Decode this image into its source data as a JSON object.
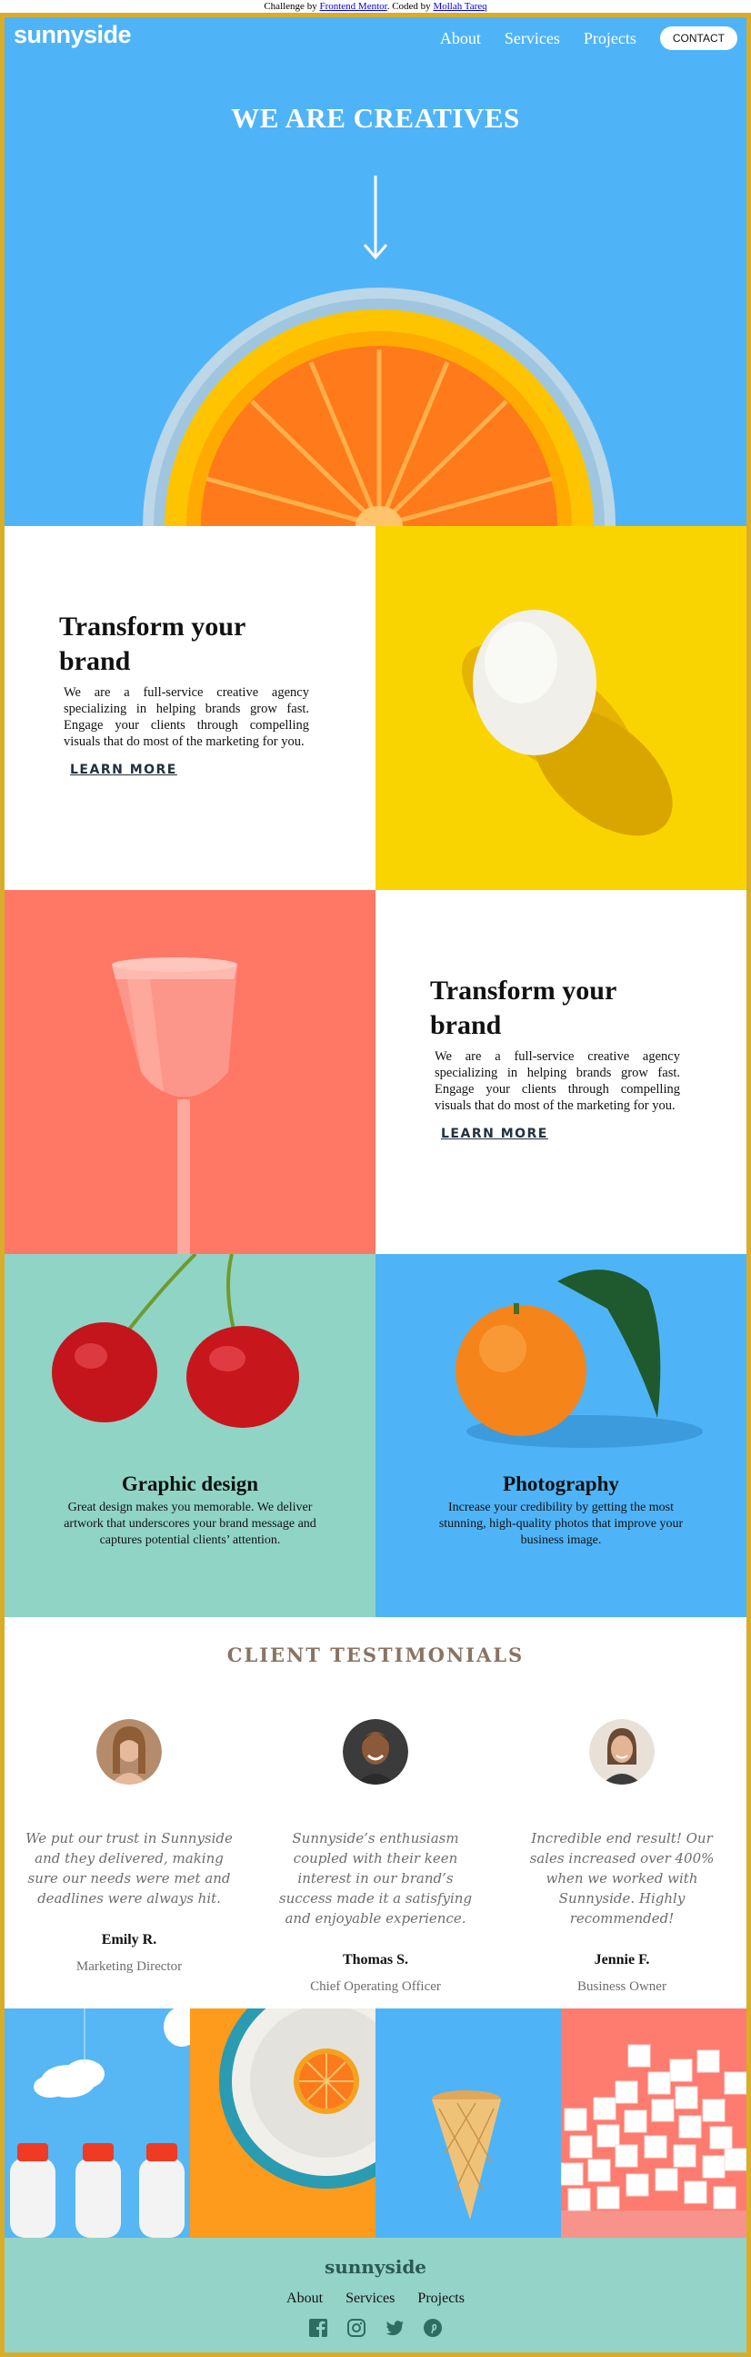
{
  "attribution": {
    "prefix": "Challenge by ",
    "link1": "Frontend Mentor",
    "middle": ". Coded by ",
    "link2": "Mollah Tareq"
  },
  "header": {
    "logo": "sunnyside",
    "nav": [
      "About",
      "Services",
      "Projects"
    ],
    "contact": "CONTACT"
  },
  "hero": {
    "title": "WE ARE CREATIVES",
    "icon": "arrow-down-icon"
  },
  "features": [
    {
      "title": "Transform your brand",
      "body": "We are a full-service creative agency specializing in helping brands grow fast. Engage your clients through compelling visuals that do most of the marketing for you.",
      "cta": "LEARN MORE"
    },
    {
      "title": "Transform your brand",
      "body": "We are a full-service creative agency specializing in helping brands grow fast. Engage your clients through compelling visuals that do most of the marketing for you.",
      "cta": "LEARN MORE"
    }
  ],
  "services": [
    {
      "title": "Graphic design",
      "body": "Great design makes you memorable. We deliver artwork that underscores your brand message and captures potential clients’ attention."
    },
    {
      "title": "Photography",
      "body": "Increase your credibility by getting the most stunning, high-quality photos that improve your business image."
    }
  ],
  "testimonials": {
    "title": "CLIENT TESTIMONIALS",
    "items": [
      {
        "quote": "We put our trust in Sunnyside and they delivered, making sure our needs were met and deadlines were always hit.",
        "name": "Emily R.",
        "role": "Marketing Director"
      },
      {
        "quote": "Sunnyside’s enthusiasm coupled with their keen interest in our brand’s success made it a satisfying and enjoyable experience.",
        "name": "Thomas S.",
        "role": "Chief Operating Officer"
      },
      {
        "quote": "Incredible end result! Our sales increased over 400% when we worked with Sunnyside. Highly recommended!",
        "name": "Jennie F.",
        "role": "Business Owner"
      }
    ]
  },
  "footer": {
    "logo": "sunnyside",
    "nav": [
      "About",
      "Services",
      "Projects"
    ],
    "social": [
      "facebook-icon",
      "instagram-icon",
      "twitter-icon",
      "pinterest-icon"
    ]
  },
  "colors": {
    "hero_blue": "#4fb4f7",
    "yellow": "#fad400",
    "coral": "#fe7865",
    "teal": "#90d4c5",
    "frame_gold": "#d8ad2a",
    "footer_teal": "#94d3c7"
  }
}
